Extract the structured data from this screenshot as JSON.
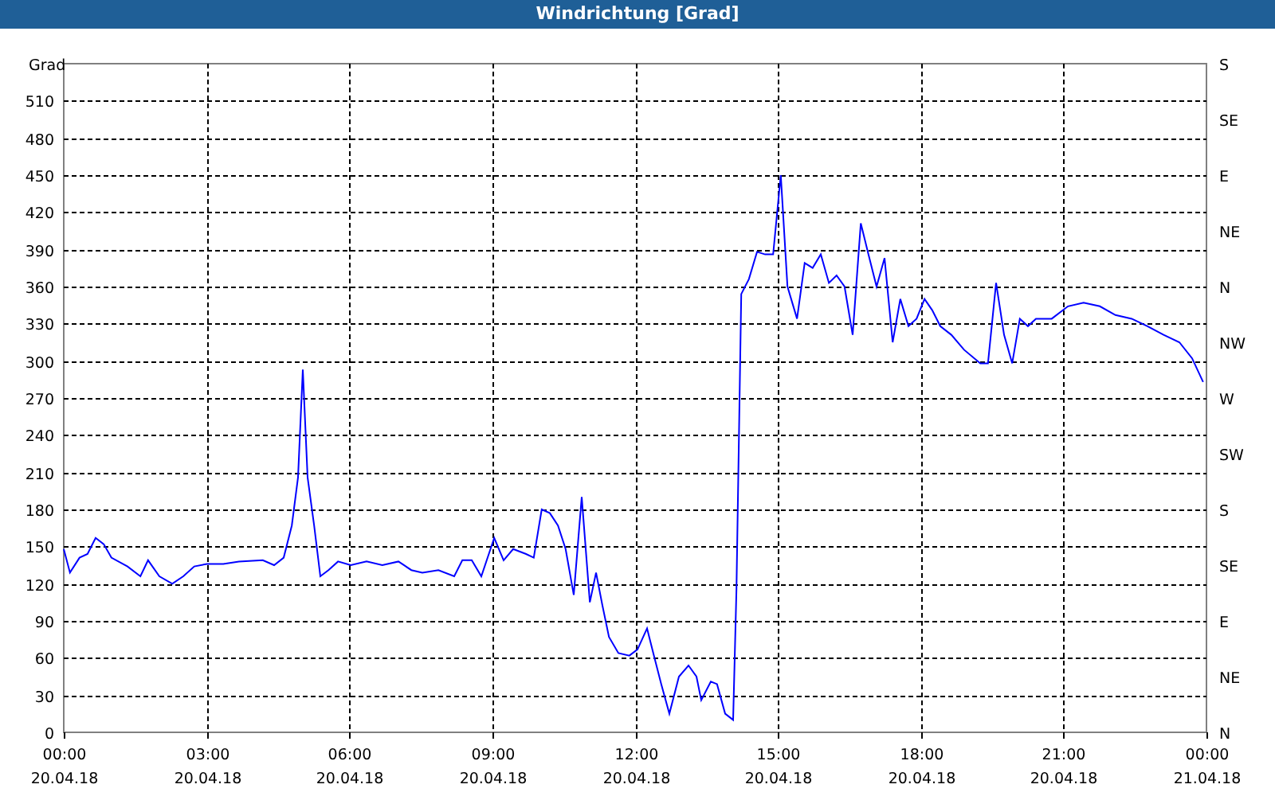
{
  "window": {
    "title": "Windrichtung [Grad]"
  },
  "chart": {
    "right_axis_labels": [
      "S",
      "SE",
      "E",
      "NE",
      "N",
      "NW",
      "W",
      "SW",
      "S",
      "SE",
      "E",
      "NE",
      "N"
    ],
    "x_axis_dates": [
      "20.04.18",
      "20.04.18",
      "20.04.18",
      "20.04.18",
      "20.04.18",
      "20.04.18",
      "20.04.18",
      "20.04.18",
      "21.04.18"
    ],
    "chart_data": {
      "type": "line",
      "ylabel": "Grad",
      "xlim": [
        0,
        24
      ],
      "ylim": [
        0,
        540
      ],
      "grid": true,
      "yticks": [
        0,
        30,
        60,
        90,
        120,
        150,
        180,
        210,
        240,
        270,
        300,
        330,
        360,
        390,
        420,
        450,
        480,
        510
      ],
      "xticks": [
        {
          "value": 0,
          "label": "00:00"
        },
        {
          "value": 3,
          "label": "03:00"
        },
        {
          "value": 6,
          "label": "06:00"
        },
        {
          "value": 9,
          "label": "09:00"
        },
        {
          "value": 12,
          "label": "12:00"
        },
        {
          "value": 15,
          "label": "15:00"
        },
        {
          "value": 18,
          "label": "18:00"
        },
        {
          "value": 21,
          "label": "21:00"
        },
        {
          "value": 24,
          "label": "00:00"
        }
      ],
      "x": [
        0,
        0.13,
        0.33,
        0.5,
        0.67,
        0.84,
        1,
        1.34,
        1.61,
        1.77,
        2.01,
        2.28,
        2.51,
        2.74,
        3.01,
        3.35,
        3.68,
        4.18,
        4.42,
        4.62,
        4.79,
        4.92,
        5.02,
        5.12,
        5.26,
        5.39,
        5.56,
        5.76,
        6.03,
        6.36,
        6.69,
        7.03,
        7.3,
        7.53,
        7.87,
        8.2,
        8.37,
        8.57,
        8.77,
        9.04,
        9.24,
        9.44,
        9.71,
        9.87,
        10.04,
        10.21,
        10.38,
        10.54,
        10.71,
        10.88,
        11.05,
        11.18,
        11.31,
        11.45,
        11.65,
        11.88,
        12.05,
        12.25,
        12.38,
        12.55,
        12.72,
        12.92,
        13.12,
        13.29,
        13.39,
        13.59,
        13.72,
        13.89,
        14.06,
        14.13,
        14.23,
        14.39,
        14.56,
        14.73,
        14.9,
        15.06,
        15.2,
        15.4,
        15.56,
        15.73,
        15.9,
        16.07,
        16.23,
        16.4,
        16.57,
        16.74,
        16.9,
        17.07,
        17.24,
        17.41,
        17.57,
        17.74,
        17.91,
        18.08,
        18.24,
        18.41,
        18.64,
        18.91,
        19.25,
        19.41,
        19.58,
        19.75,
        19.92,
        20.08,
        20.25,
        20.42,
        20.75,
        21.09,
        21.42,
        21.76,
        22.09,
        22.43,
        22.76,
        23.1,
        23.43,
        23.7,
        23.93
      ],
      "values": [
        148,
        129,
        141,
        144,
        157,
        152,
        141,
        134,
        126,
        139,
        126,
        120,
        126,
        134,
        136,
        136,
        138,
        139,
        135,
        141,
        167,
        206,
        293,
        206,
        167,
        126,
        131,
        138,
        135,
        138,
        135,
        138,
        131,
        129,
        131,
        126,
        139,
        139,
        126,
        157,
        139,
        148,
        144,
        141,
        180,
        177,
        167,
        148,
        111,
        190,
        105,
        129,
        103,
        77,
        64,
        62,
        67,
        84,
        64,
        39,
        15,
        45,
        54,
        45,
        26,
        41,
        39,
        15,
        10,
        116,
        354,
        366,
        388,
        386,
        386,
        450,
        360,
        334,
        379,
        375,
        386,
        363,
        369,
        360,
        321,
        411,
        386,
        360,
        383,
        315,
        350,
        328,
        334,
        350,
        341,
        328,
        321,
        309,
        298,
        298,
        363,
        321,
        298,
        334,
        328,
        334,
        334,
        344,
        347,
        344,
        337,
        334,
        328,
        321,
        315,
        302,
        283
      ]
    }
  }
}
